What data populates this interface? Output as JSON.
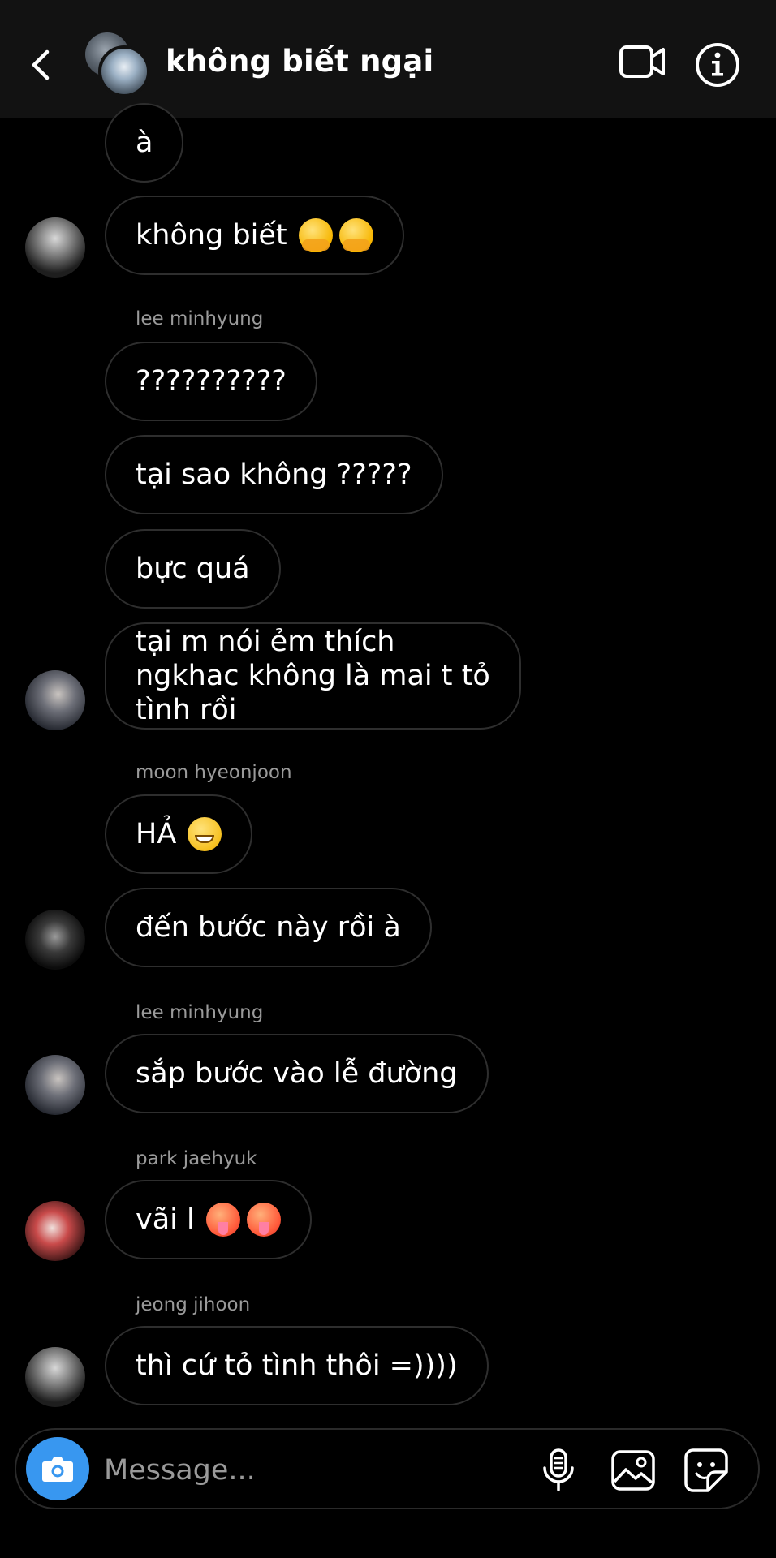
{
  "header": {
    "title": "không biết ngại",
    "back_icon": "chevron-left-icon",
    "video_icon": "video-camera-icon",
    "info_icon": "info-icon"
  },
  "messages": [
    {
      "text": "à"
    },
    {
      "text": "không biết"
    },
    {
      "sender": "lee minhyung",
      "text": "??????????"
    },
    {
      "text": "tại sao không ?????"
    },
    {
      "text": "bực quá"
    },
    {
      "text": "tại m nói ẻm thích ngkhac không là mai t tỏ tình rồi"
    },
    {
      "sender": "moon hyeonjoon",
      "text": "HẢ"
    },
    {
      "text": "đến bước này rồi à"
    },
    {
      "sender": "lee minhyung",
      "text": "sắp bước vào lễ đường"
    },
    {
      "sender": "park jaehyuk",
      "text": "vãi l"
    },
    {
      "sender": "jeong jihoon",
      "text": "thì cứ tỏ tình thôi =))))"
    }
  ],
  "composer": {
    "placeholder": "Message...",
    "camera_icon": "camera-icon",
    "mic_icon": "microphone-icon",
    "gallery_icon": "gallery-icon",
    "sticker_icon": "sticker-icon"
  },
  "colors": {
    "background": "#000000",
    "header": "#121212",
    "bubble_border": "#2e2e2e",
    "accent": "#3897f0",
    "secondary_text": "#9a9a9a"
  }
}
